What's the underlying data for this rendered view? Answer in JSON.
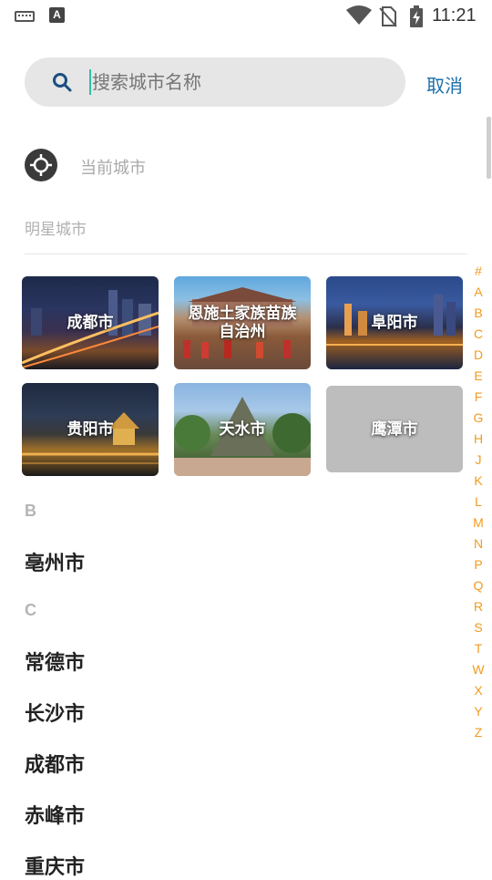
{
  "status_bar": {
    "time": "11:21",
    "app_icon_letter": "A"
  },
  "search": {
    "placeholder": "搜索城市名称",
    "value": "",
    "cancel_label": "取消"
  },
  "current_city": {
    "label": "当前城市"
  },
  "star_cities": {
    "title": "明星城市",
    "items": [
      {
        "name": "成都市",
        "theme": "night-city"
      },
      {
        "name": "恩施土家族苗族自治州",
        "theme": "ethnic-square"
      },
      {
        "name": "阜阳市",
        "theme": "night-lake"
      },
      {
        "name": "贵阳市",
        "theme": "night-pavilion"
      },
      {
        "name": "天水市",
        "theme": "mountain-day"
      },
      {
        "name": "鹰潭市",
        "theme": "placeholder"
      }
    ]
  },
  "sections": [
    {
      "letter": "B",
      "cities": [
        "亳州市"
      ]
    },
    {
      "letter": "C",
      "cities": [
        "常德市",
        "长沙市",
        "成都市",
        "赤峰市",
        "重庆市"
      ]
    }
  ],
  "alphabet_index": [
    "#",
    "A",
    "B",
    "C",
    "D",
    "E",
    "F",
    "G",
    "H",
    "J",
    "K",
    "L",
    "M",
    "N",
    "P",
    "Q",
    "R",
    "S",
    "T",
    "W",
    "X",
    "Y",
    "Z"
  ],
  "colors": {
    "accent": "#1b6fa8",
    "index": "#f39a1e",
    "cursor": "#2fbfa8"
  }
}
